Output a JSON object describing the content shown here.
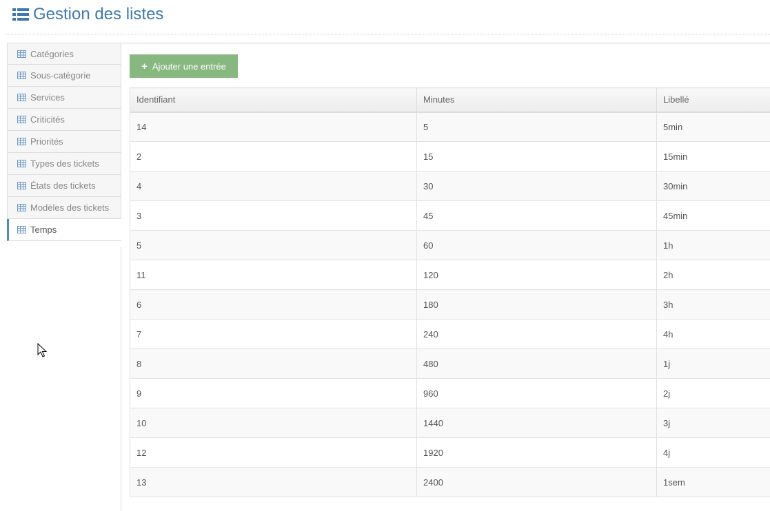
{
  "header": {
    "title": "Gestion des listes",
    "icon": "list-icon",
    "title_color": "#3e79b4"
  },
  "sidebar": {
    "items": [
      {
        "label": "Catégories",
        "icon": "table-icon",
        "active": false
      },
      {
        "label": "Sous-catégorie",
        "icon": "table-icon",
        "active": false
      },
      {
        "label": "Services",
        "icon": "table-icon",
        "active": false
      },
      {
        "label": "Criticités",
        "icon": "table-icon",
        "active": false
      },
      {
        "label": "Priorités",
        "icon": "table-icon",
        "active": false
      },
      {
        "label": "Types des tickets",
        "icon": "table-icon",
        "active": false
      },
      {
        "label": "États des tickets",
        "icon": "table-icon",
        "active": false
      },
      {
        "label": "Modèles des tickets",
        "icon": "table-icon",
        "active": false
      },
      {
        "label": "Temps",
        "icon": "table-icon",
        "active": true
      }
    ],
    "active_accent": "#4a89c8"
  },
  "toolbar": {
    "add_label": "Ajouter une entrée",
    "add_icon": "plus-icon",
    "add_color": "#87b87f"
  },
  "table": {
    "columns": [
      "Identifiant",
      "Minutes",
      "Libellé"
    ],
    "rows": [
      [
        "14",
        "5",
        "5min"
      ],
      [
        "2",
        "15",
        "15min"
      ],
      [
        "4",
        "30",
        "30min"
      ],
      [
        "3",
        "45",
        "45min"
      ],
      [
        "5",
        "60",
        "1h"
      ],
      [
        "11",
        "120",
        "2h"
      ],
      [
        "6",
        "180",
        "3h"
      ],
      [
        "7",
        "240",
        "4h"
      ],
      [
        "8",
        "480",
        "1j"
      ],
      [
        "9",
        "960",
        "2j"
      ],
      [
        "10",
        "1440",
        "3j"
      ],
      [
        "12",
        "1920",
        "4j"
      ],
      [
        "13",
        "2400",
        "1sem"
      ]
    ]
  }
}
